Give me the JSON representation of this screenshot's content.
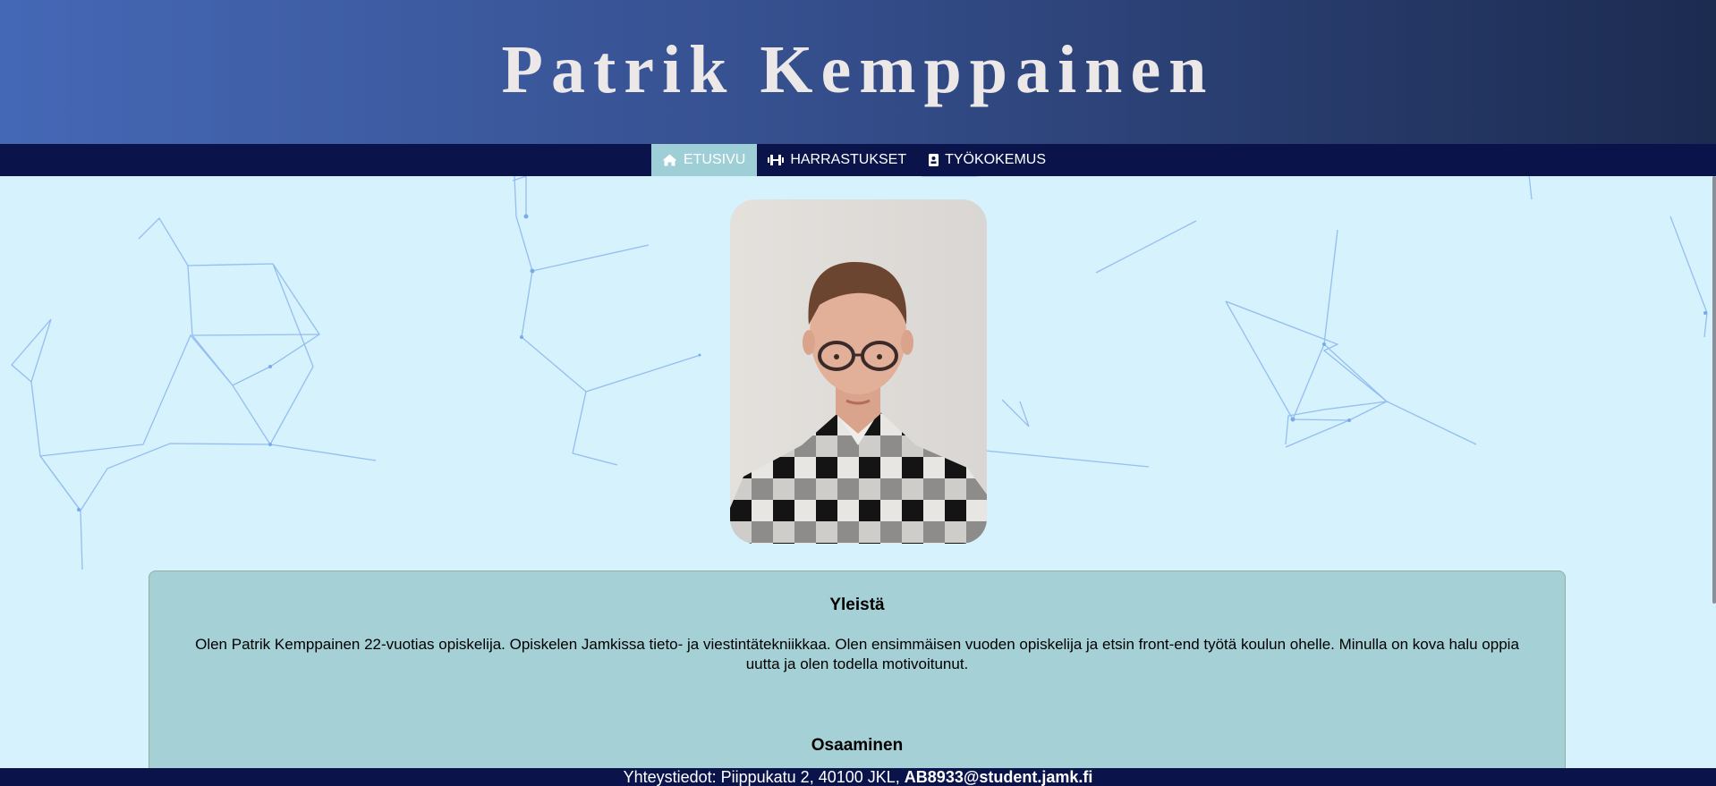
{
  "header": {
    "name": "Patrik Kemppainen"
  },
  "nav": {
    "items": [
      {
        "label": "ETUSIVU",
        "icon": "home-icon",
        "active": true
      },
      {
        "label": "HARRASTUKSET",
        "icon": "dumbbell-icon",
        "active": false
      },
      {
        "label": "TYÖKOKEMUS",
        "icon": "id-badge-icon",
        "active": false
      }
    ]
  },
  "main": {
    "general_title": "Yleistä",
    "general_text": "Olen Patrik Kemppainen 22-vuotias opiskelija. Opiskelen Jamkissa tieto- ja viestintätekniikkaa. Olen ensimmäisen vuoden opiskelija ja etsin front-end työtä koulun ohelle. Minulla on kova halu oppia uutta ja olen todella motivoitunut.",
    "skills_title": "Osaaminen"
  },
  "footer": {
    "contact_text": "Yhteystiedot: Piippukatu 2, 40100 JKL,",
    "email": "AB8933@student.jamk.fi"
  },
  "colors": {
    "header_gradient_start": "#4568b6",
    "header_gradient_end": "#1c2b50",
    "nav_background": "#0a144a",
    "nav_active": "#9fcfd6",
    "page_background": "#d5f2fd",
    "card_background": "#a5d0d5"
  }
}
